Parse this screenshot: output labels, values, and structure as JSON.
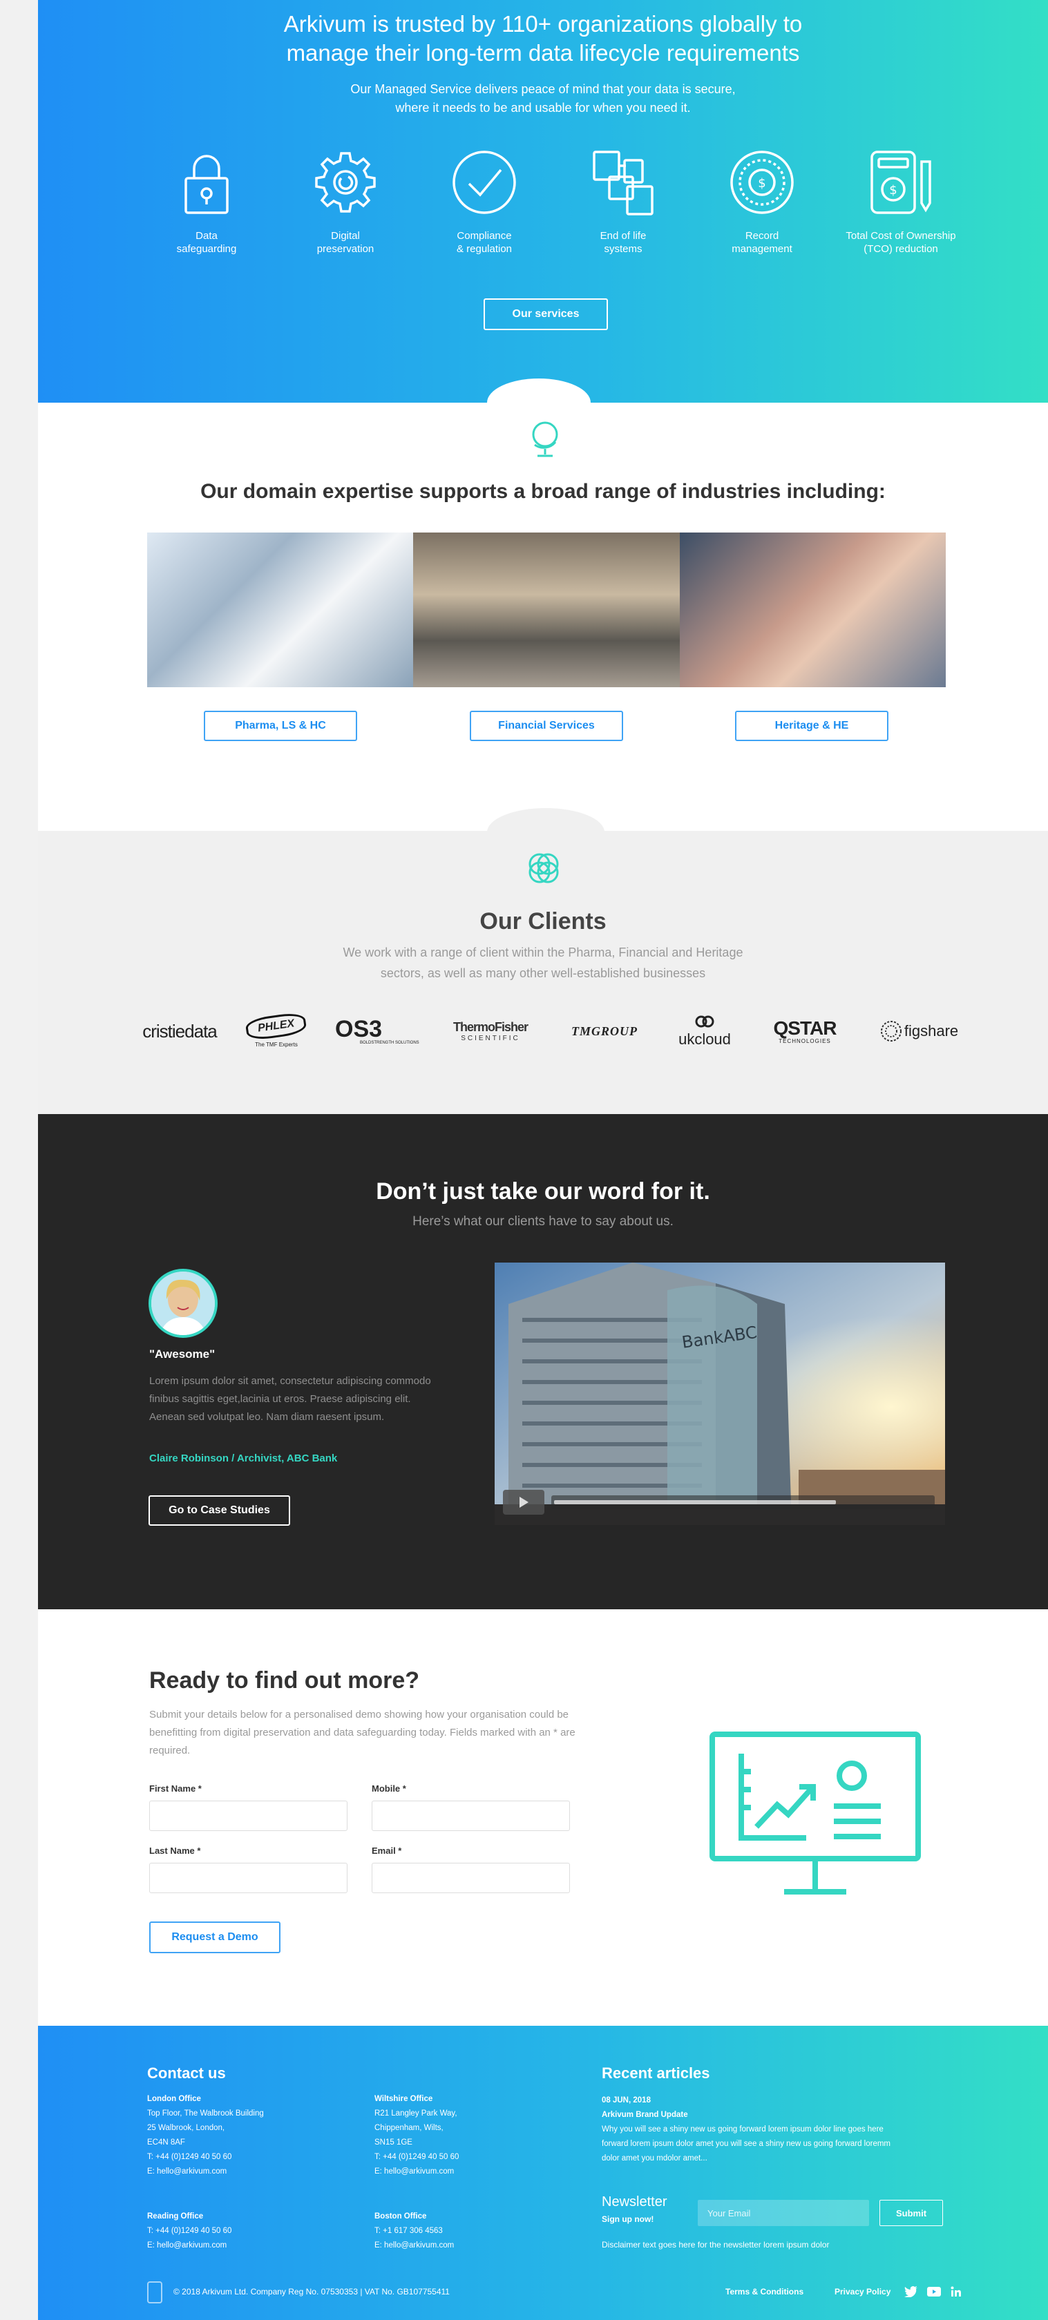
{
  "hero": {
    "title_line1": "Arkivum is trusted by 110+ organizations globally to",
    "title_line2": "manage their long-term data lifecycle requirements",
    "subtitle_line1": "Our Managed Service delivers peace of mind that your data is secure,",
    "subtitle_line2": "where it needs to be and usable for when you need it.",
    "features": [
      {
        "icon": "lock-icon",
        "line1": "Data",
        "line2": "safeguarding"
      },
      {
        "icon": "gear-icon",
        "line1": "Digital",
        "line2": "preservation"
      },
      {
        "icon": "check-circle-icon",
        "line1": "Compliance",
        "line2": "& regulation"
      },
      {
        "icon": "stacked-documents-icon",
        "line1": "End of life",
        "line2": "systems"
      },
      {
        "icon": "record-dial-icon",
        "line1": "Record",
        "line2": "management"
      },
      {
        "icon": "calculator-dollar-icon",
        "line1": "Total Cost of Ownership",
        "line2": "(TCO) reduction"
      }
    ],
    "services_button": "Our services"
  },
  "domain": {
    "heading": "Our domain expertise supports a broad range of industries including:",
    "industries": [
      "Pharma, LS & HC",
      "Financial Services",
      "Heritage & HE"
    ]
  },
  "clients": {
    "heading": "Our Clients",
    "desc_line1": "We work with a range of client within the Pharma, Financial and Heritage",
    "desc_line2": "sectors, as well as many other well-established businesses",
    "logos": {
      "cristie": "cristiedata",
      "phlex": "PHLEX",
      "phlex_tag": "The TMF Experts",
      "os3": "OS3",
      "os3_tag": "BOLDSTRENGTH SOLUTIONS",
      "thermo_line1": "ThermoFisher",
      "thermo_line2": "SCIENTIFIC",
      "tmgroup": "TMGROUP",
      "ukcloud": "ukcloud",
      "qstar": "QSTAR",
      "qstar_tag": "TECHNOLOGIES",
      "figshare": "figshare"
    }
  },
  "testimonial": {
    "heading": "Don’t just take our word for it.",
    "subheading": "Here’s what our clients have to say about us.",
    "quote_title": "\"Awesome\"",
    "quote_body": "Lorem ipsum dolor sit amet, consectetur adipiscing commodo finibus sagittis eget,lacinia ut eros. Praese adipiscing elit. Aenean sed volutpat leo. Nam diam raesent ipsum.",
    "author": "Claire Robinson / Archivist, ABC Bank",
    "case_button": "Go to Case Studies",
    "video_sign": "BankABC",
    "video_progress": 0.75
  },
  "form": {
    "heading": "Ready to find out more?",
    "intro": "Submit your details below for a personalised demo showing how your organisation could be benefitting from digital preservation and data safeguarding today. Fields marked with an * are required.",
    "first_name_label": "First Name *",
    "mobile_label": "Mobile *",
    "last_name_label": "Last Name *",
    "email_label": "Email *",
    "submit": "Request a Demo",
    "accent_color": "#35d6c2"
  },
  "footer": {
    "contact_heading": "Contact us",
    "offices": [
      {
        "name": "London Office",
        "lines": [
          "Top Floor, The Walbrook Building",
          "25 Walbrook, London,",
          "EC4N 8AF",
          "T: +44 (0)1249 40 50 60",
          "E: hello@arkivum.com"
        ]
      },
      {
        "name": "Wiltshire Office",
        "lines": [
          "R21 Langley Park Way,",
          "Chippenham, Wilts,",
          "SN15 1GE",
          "T: +44 (0)1249 40 50 60",
          "E: hello@arkivum.com"
        ]
      },
      {
        "name": "Reading Office",
        "lines": [
          "T: +44 (0)1249 40 50 60",
          "E: hello@arkivum.com"
        ]
      },
      {
        "name": "Boston Office",
        "lines": [
          "T: +1 617 306 4563",
          "E: hello@arkivum.com"
        ]
      }
    ],
    "recent_heading": "Recent articles",
    "article_date": "08 JUN, 2018",
    "article_title": "Arkivum Brand Update",
    "article_body": "Why you will see a shiny new us going forward lorem ipsum dolor line goes here forward lorem ipsum dolor amet you will see a shiny new us going forward loremm dolor amet you mdolor amet...",
    "newsletter_title": "Newsletter",
    "newsletter_sub": "Sign up now!",
    "email_placeholder": "Your Email",
    "submit": "Submit",
    "disclaimer": "Disclaimer text goes here for the newsletter lorem ipsum dolor",
    "copyright": "© 2018 Arkivum Ltd. Company Reg No. 07530353 | VAT No. GB107755411",
    "terms": "Terms & Conditions",
    "privacy": "Privacy Policy",
    "social": [
      "twitter-icon",
      "youtube-icon",
      "linkedin-icon"
    ]
  }
}
